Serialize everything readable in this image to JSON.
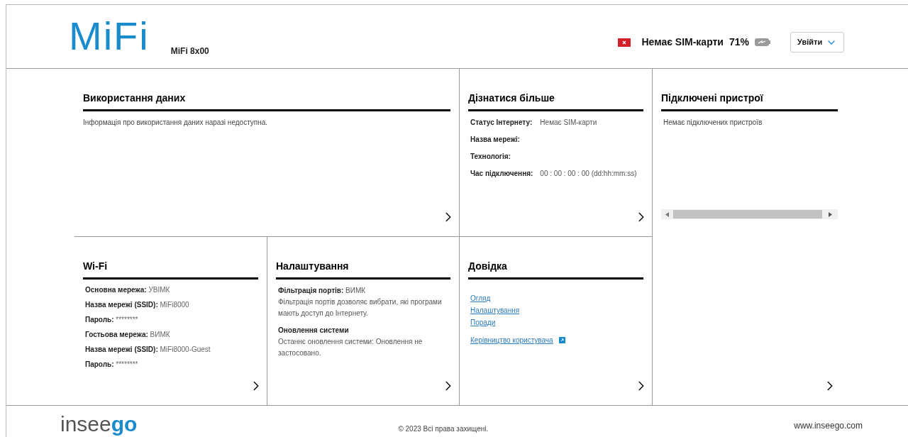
{
  "header": {
    "logo": "MiFi",
    "model": "MiFi 8x00",
    "sim_status": "Немає SIM-карти",
    "battery": "71%",
    "login_button": "Увійти"
  },
  "data_usage": {
    "title": "Використання даних",
    "message": "Інформація про використання даних наразі недоступна."
  },
  "learn_more": {
    "title": "Дізнатися більше",
    "rows": [
      {
        "label": "Статус Інтернету:",
        "value": "Немає SIM-карти"
      },
      {
        "label": "Назва мережі:"
      },
      {
        "label": "Технологія:"
      },
      {
        "label": "Час підключення:",
        "value": "00 : 00 : 00 : 00 (dd:hh:mm:ss)"
      }
    ]
  },
  "connected_devices": {
    "title": "Підключені пристрої",
    "message": "Немає підключених пристроїв"
  },
  "wifi": {
    "title": "Wi-Fi",
    "rows": [
      {
        "label": "Основна мережа:",
        "value": "УВІМК"
      },
      {
        "label": "Назва мережі (SSID):",
        "value": "MiFi8000"
      },
      {
        "label": "Пароль:",
        "value": "********"
      },
      {
        "label": "Гостьова мережа:",
        "value": "ВИМК"
      },
      {
        "label": "Назва мережі (SSID):",
        "value": "MiFi8000-Guest"
      },
      {
        "label": "Пароль:",
        "value": "********"
      }
    ]
  },
  "settings": {
    "title": "Налаштування",
    "port_filter": {
      "label": "Фільтрація портів:",
      "value": "ВИМК"
    },
    "description": "Фільтрація портів дозволяє вибрати, які програми мають доступ до Інтернету.",
    "update_title": "Оновлення системи",
    "update_text": "Останнє оновлення системи: Оновлення не застосовано."
  },
  "help": {
    "title": "Довідка",
    "links": [
      {
        "text": "Огляд",
        "external": false
      },
      {
        "text": "Налаштування",
        "external": false
      },
      {
        "text": "Поради",
        "external": false
      },
      {
        "text": "Керівництво користувача",
        "external": true
      }
    ]
  },
  "footer": {
    "logo_main": "insee",
    "logo_accent": "go",
    "copyright": "© 2023 Всі права захищені.",
    "website": "www.inseego.com"
  }
}
